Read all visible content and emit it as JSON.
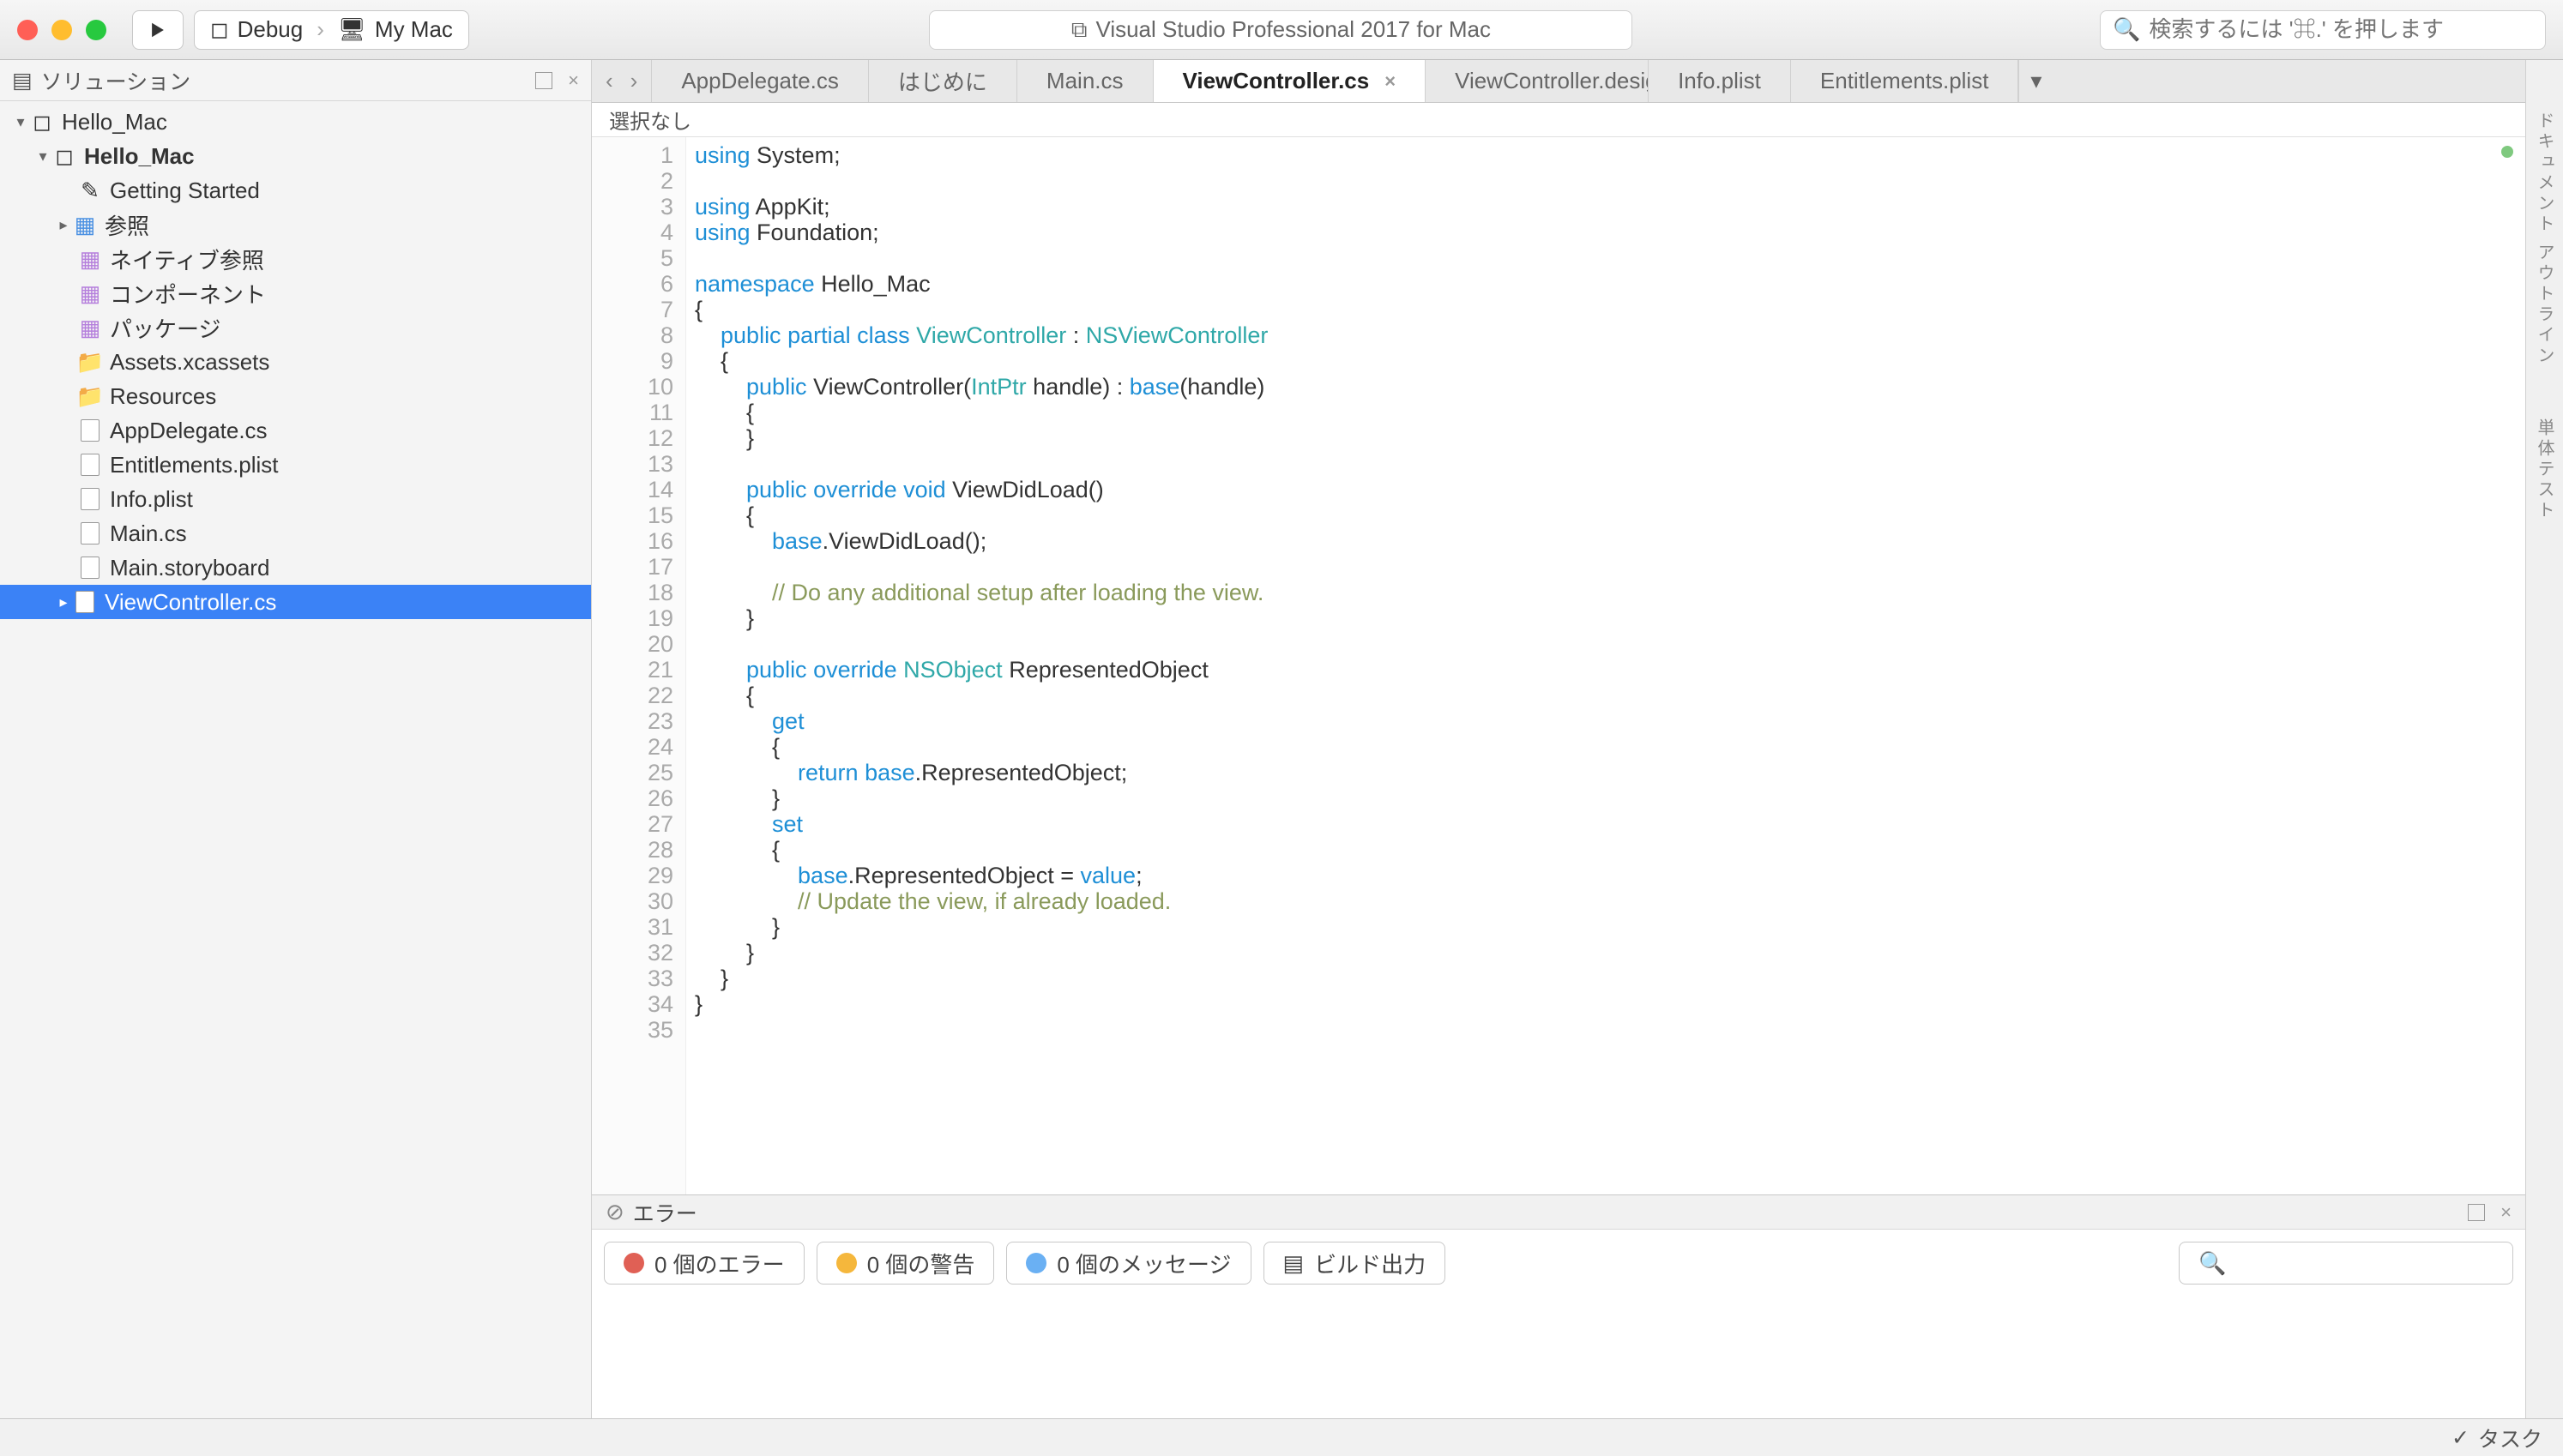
{
  "toolbar": {
    "debug_label": "Debug",
    "target_label": "My Mac",
    "title": "Visual Studio Professional 2017 for Mac",
    "search_placeholder": "検索するには '⌘.' を押します"
  },
  "sidebar": {
    "title": "ソリューション",
    "tree": {
      "sol": "Hello_Mac",
      "proj": "Hello_Mac",
      "getting_started": "Getting Started",
      "refs": "参照",
      "native_refs": "ネイティブ参照",
      "components": "コンポーネント",
      "packages": "パッケージ",
      "assets": "Assets.xcassets",
      "resources": "Resources",
      "appdelegate": "AppDelegate.cs",
      "entitlements": "Entitlements.plist",
      "info": "Info.plist",
      "main": "Main.cs",
      "storyboard": "Main.storyboard",
      "viewcontroller": "ViewController.cs"
    }
  },
  "tabs": {
    "t0": "AppDelegate.cs",
    "t1": "はじめに",
    "t2": "Main.cs",
    "t3": "ViewController.cs",
    "t4": "ViewController.designer.cs",
    "t5": "Info.plist",
    "t6": "Entitlements.plist"
  },
  "breadcrumb": "選択なし",
  "right_strip": {
    "a": "ドキュメント アウトライン",
    "b": "単体テスト"
  },
  "errors": {
    "title": "エラー",
    "err": "0 個のエラー",
    "warn": "0 個の警告",
    "msg": "0 個のメッセージ",
    "build": "ビルド出力"
  },
  "status": {
    "task": "タスク"
  },
  "code": {
    "line_count": 35,
    "lines": [
      [
        [
          "kw",
          "using"
        ],
        [
          "iden",
          " System;"
        ]
      ],
      [],
      [
        [
          "kw",
          "using"
        ],
        [
          "iden",
          " AppKit;"
        ]
      ],
      [
        [
          "kw",
          "using"
        ],
        [
          "iden",
          " Foundation;"
        ]
      ],
      [],
      [
        [
          "kw",
          "namespace"
        ],
        [
          "iden",
          " Hello_Mac"
        ]
      ],
      [
        [
          "iden",
          "{"
        ]
      ],
      [
        [
          "iden",
          "    "
        ],
        [
          "kw",
          "public"
        ],
        [
          "iden",
          " "
        ],
        [
          "kw",
          "partial"
        ],
        [
          "iden",
          " "
        ],
        [
          "kw",
          "class"
        ],
        [
          "iden",
          " "
        ],
        [
          "type",
          "ViewController"
        ],
        [
          "iden",
          " : "
        ],
        [
          "type",
          "NSViewController"
        ]
      ],
      [
        [
          "iden",
          "    {"
        ]
      ],
      [
        [
          "iden",
          "        "
        ],
        [
          "kw",
          "public"
        ],
        [
          "iden",
          " ViewController("
        ],
        [
          "type",
          "IntPtr"
        ],
        [
          "iden",
          " handle) : "
        ],
        [
          "kw",
          "base"
        ],
        [
          "iden",
          "(handle)"
        ]
      ],
      [
        [
          "iden",
          "        {"
        ]
      ],
      [
        [
          "iden",
          "        }"
        ]
      ],
      [],
      [
        [
          "iden",
          "        "
        ],
        [
          "kw",
          "public"
        ],
        [
          "iden",
          " "
        ],
        [
          "kw",
          "override"
        ],
        [
          "iden",
          " "
        ],
        [
          "kw",
          "void"
        ],
        [
          "iden",
          " ViewDidLoad()"
        ]
      ],
      [
        [
          "iden",
          "        {"
        ]
      ],
      [
        [
          "iden",
          "            "
        ],
        [
          "kw",
          "base"
        ],
        [
          "iden",
          ".ViewDidLoad();"
        ]
      ],
      [],
      [
        [
          "iden",
          "            "
        ],
        [
          "comment",
          "// Do any additional setup after loading the view."
        ]
      ],
      [
        [
          "iden",
          "        }"
        ]
      ],
      [],
      [
        [
          "iden",
          "        "
        ],
        [
          "kw",
          "public"
        ],
        [
          "iden",
          " "
        ],
        [
          "kw",
          "override"
        ],
        [
          "iden",
          " "
        ],
        [
          "type",
          "NSObject"
        ],
        [
          "iden",
          " RepresentedObject"
        ]
      ],
      [
        [
          "iden",
          "        {"
        ]
      ],
      [
        [
          "iden",
          "            "
        ],
        [
          "kw",
          "get"
        ]
      ],
      [
        [
          "iden",
          "            {"
        ]
      ],
      [
        [
          "iden",
          "                "
        ],
        [
          "kw",
          "return"
        ],
        [
          "iden",
          " "
        ],
        [
          "kw",
          "base"
        ],
        [
          "iden",
          ".RepresentedObject;"
        ]
      ],
      [
        [
          "iden",
          "            }"
        ]
      ],
      [
        [
          "iden",
          "            "
        ],
        [
          "kw",
          "set"
        ]
      ],
      [
        [
          "iden",
          "            {"
        ]
      ],
      [
        [
          "iden",
          "                "
        ],
        [
          "kw",
          "base"
        ],
        [
          "iden",
          ".RepresentedObject = "
        ],
        [
          "kw",
          "value"
        ],
        [
          "iden",
          ";"
        ]
      ],
      [
        [
          "iden",
          "                "
        ],
        [
          "comment",
          "// Update the view, if already loaded."
        ]
      ],
      [
        [
          "iden",
          "            }"
        ]
      ],
      [
        [
          "iden",
          "        }"
        ]
      ],
      [
        [
          "iden",
          "    }"
        ]
      ],
      [
        [
          "iden",
          "}"
        ]
      ],
      []
    ]
  }
}
